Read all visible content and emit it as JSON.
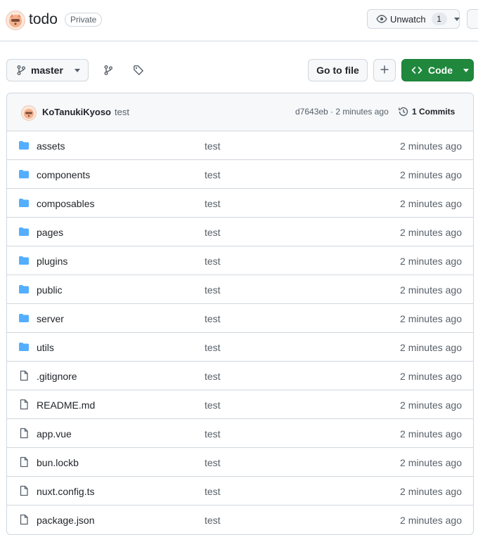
{
  "repo": {
    "name": "todo",
    "visibility": "Private"
  },
  "watch": {
    "label": "Unwatch",
    "count": "1"
  },
  "toolbar": {
    "branch": "master",
    "go_to_file": "Go to file",
    "code_label": "Code"
  },
  "colors": {
    "accent_green": "#1f883d",
    "folder_blue": "#54aeff",
    "border": "#d0d7de"
  },
  "commit": {
    "author": "KoTanukiKyoso",
    "message": "test",
    "meta": "d7643eb · 2 minutes ago",
    "commits_label": "1 Commits"
  },
  "files": [
    {
      "type": "folder",
      "name": "assets",
      "message": "test",
      "age": "2 minutes ago"
    },
    {
      "type": "folder",
      "name": "components",
      "message": "test",
      "age": "2 minutes ago"
    },
    {
      "type": "folder",
      "name": "composables",
      "message": "test",
      "age": "2 minutes ago"
    },
    {
      "type": "folder",
      "name": "pages",
      "message": "test",
      "age": "2 minutes ago"
    },
    {
      "type": "folder",
      "name": "plugins",
      "message": "test",
      "age": "2 minutes ago"
    },
    {
      "type": "folder",
      "name": "public",
      "message": "test",
      "age": "2 minutes ago"
    },
    {
      "type": "folder",
      "name": "server",
      "message": "test",
      "age": "2 minutes ago"
    },
    {
      "type": "folder",
      "name": "utils",
      "message": "test",
      "age": "2 minutes ago"
    },
    {
      "type": "file",
      "name": ".gitignore",
      "message": "test",
      "age": "2 minutes ago"
    },
    {
      "type": "file",
      "name": "README.md",
      "message": "test",
      "age": "2 minutes ago"
    },
    {
      "type": "file",
      "name": "app.vue",
      "message": "test",
      "age": "2 minutes ago"
    },
    {
      "type": "file",
      "name": "bun.lockb",
      "message": "test",
      "age": "2 minutes ago"
    },
    {
      "type": "file",
      "name": "nuxt.config.ts",
      "message": "test",
      "age": "2 minutes ago"
    },
    {
      "type": "file",
      "name": "package.json",
      "message": "test",
      "age": "2 minutes ago"
    }
  ]
}
